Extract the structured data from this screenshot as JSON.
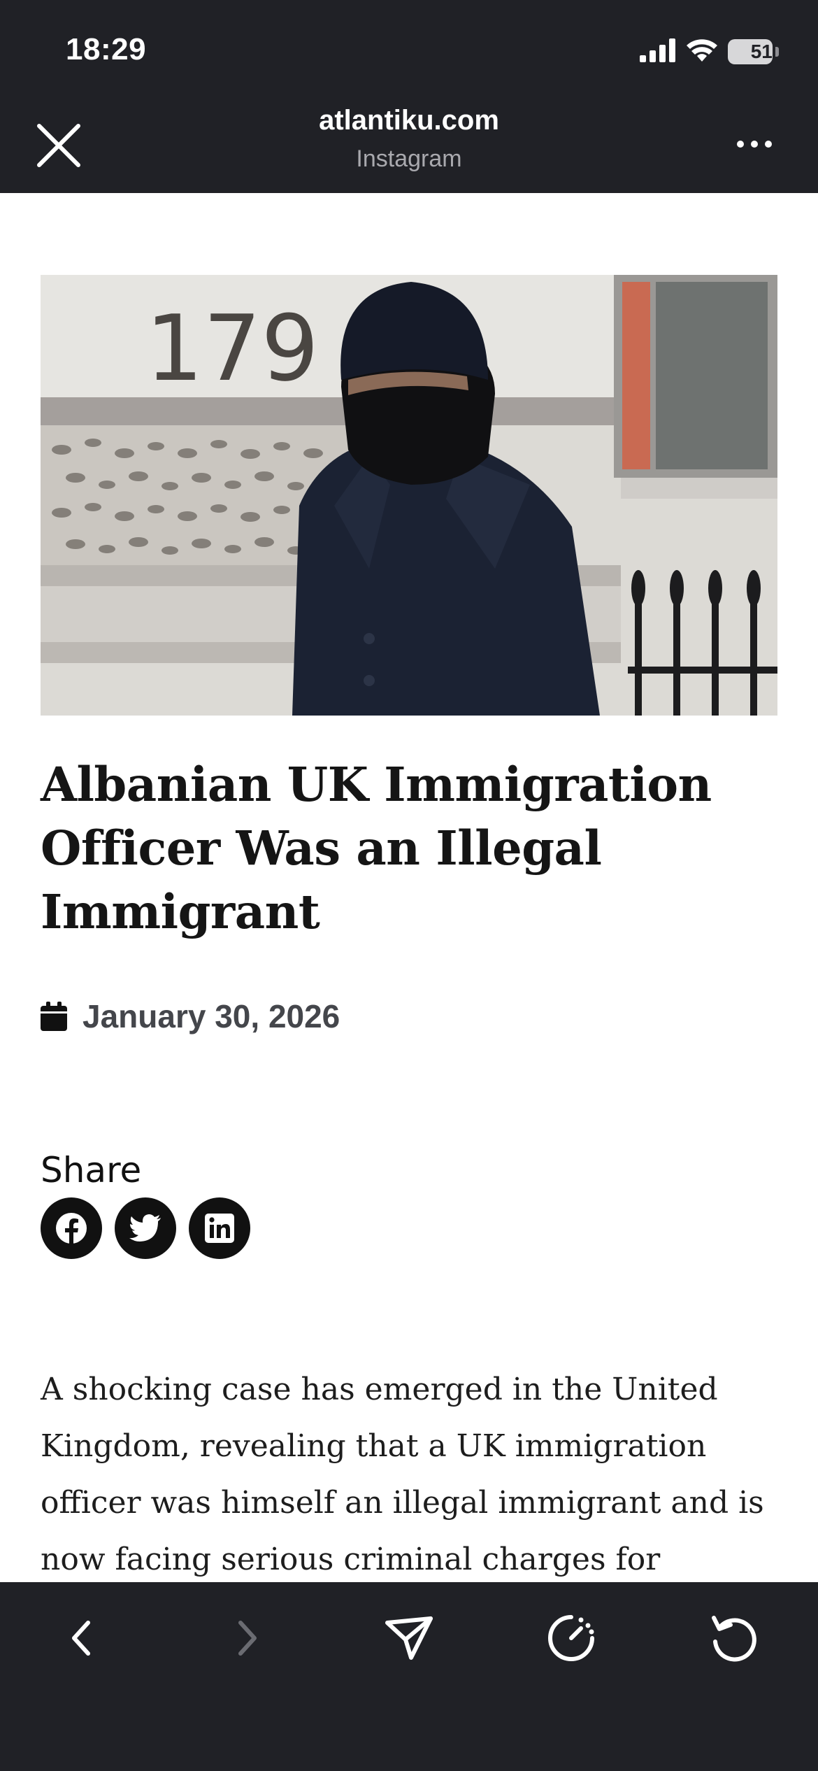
{
  "status_bar": {
    "time": "18:29",
    "battery_percent": "51",
    "battery_level": 0.51,
    "icons": [
      "cellular-signal-icon",
      "wifi-icon",
      "battery-icon"
    ]
  },
  "browser": {
    "domain": "atlantiku.com",
    "source_app": "Instagram",
    "close_icon": "close-icon",
    "more_icon": "more-icon"
  },
  "article": {
    "hero_image": "photo of a man in a black beanie, face covering and navy coat in front of building number 179",
    "hero_building_number": "179",
    "headline": "Albanian UK Immigration Officer Was an Illegal Immigrant",
    "date": "January 30, 2026",
    "date_icon": "calendar-icon",
    "share_label": "Share",
    "share_buttons": [
      {
        "name": "facebook-share-button",
        "icon": "facebook-icon"
      },
      {
        "name": "twitter-share-button",
        "icon": "twitter-icon"
      },
      {
        "name": "linkedin-share-button",
        "icon": "linkedin-icon"
      }
    ],
    "body": "A shocking case has emerged in the United Kingdom, revealing that a UK immigration officer was himself an illegal immigrant and is now facing serious criminal charges for"
  },
  "toolbar": {
    "buttons": [
      "back-icon",
      "forward-icon",
      "share-icon",
      "speedometer-icon",
      "reload-icon"
    ],
    "colors": {
      "active": "#ffffff",
      "disabled": "#6b6c72",
      "background": "#202126"
    }
  }
}
